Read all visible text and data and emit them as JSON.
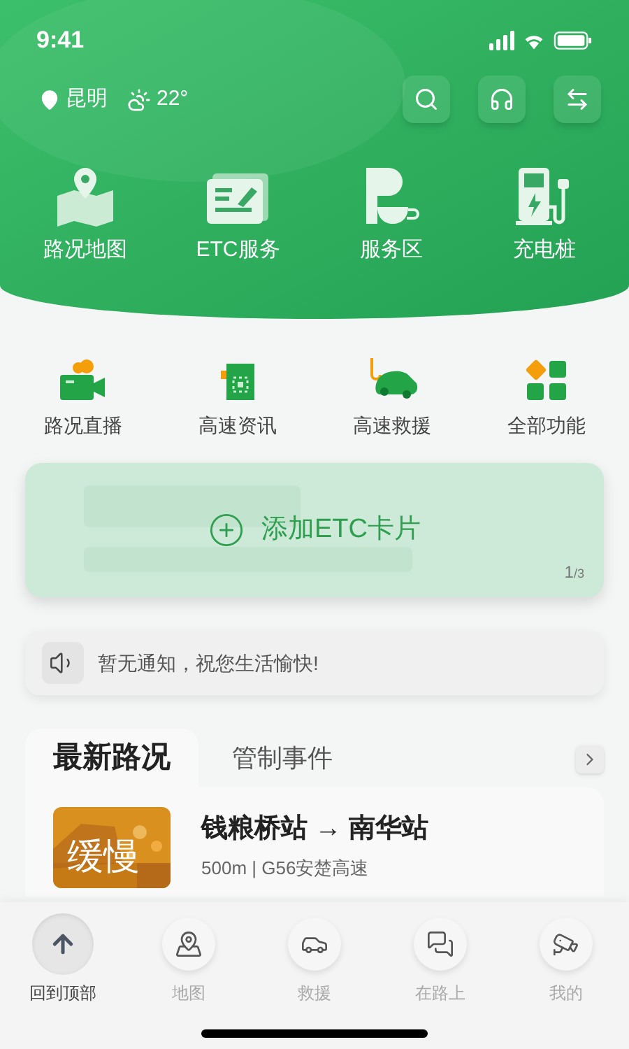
{
  "status_bar": {
    "time": "9:41"
  },
  "header": {
    "city": "昆明",
    "temperature": "22°"
  },
  "main_services": [
    {
      "kind": "map",
      "label": "路况地图"
    },
    {
      "kind": "etc",
      "label": "ETC服务"
    },
    {
      "kind": "parking",
      "label": "服务区"
    },
    {
      "kind": "charger",
      "label": "充电桩"
    }
  ],
  "quick_services": [
    {
      "kind": "camera",
      "label": "路况直播"
    },
    {
      "kind": "news",
      "label": "高速资讯"
    },
    {
      "kind": "tow",
      "label": "高速救援"
    },
    {
      "kind": "grid",
      "label": "全部功能"
    }
  ],
  "etc_card": {
    "label": "添加ETC卡片",
    "page": "1",
    "total": "/3"
  },
  "notice": {
    "text": "暂无通知，祝您生活愉快!"
  },
  "tabs": [
    {
      "label": "最新路况",
      "selected": true
    },
    {
      "label": "管制事件",
      "selected": false
    }
  ],
  "road_items": [
    {
      "status": "缓慢",
      "route": "钱粮桥站 → 南华站",
      "detail": "500m | G56安楚高速"
    }
  ],
  "bottom_nav": [
    {
      "kind": "top",
      "label": "回到顶部",
      "selected": true
    },
    {
      "kind": "map",
      "label": "地图",
      "selected": false
    },
    {
      "kind": "rescue",
      "label": "救援",
      "selected": false
    },
    {
      "kind": "chat",
      "label": "在路上",
      "selected": false
    },
    {
      "kind": "me",
      "label": "我的",
      "selected": false
    }
  ]
}
